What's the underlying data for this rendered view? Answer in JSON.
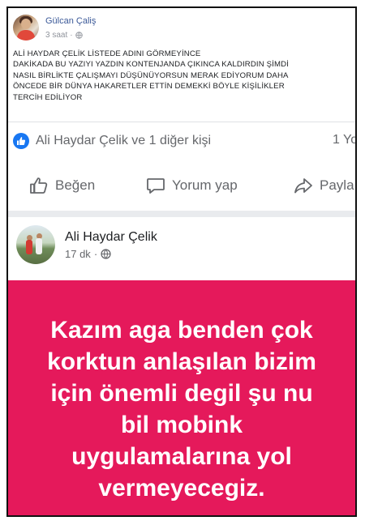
{
  "post1": {
    "author": "Gülcan Çaliş",
    "time": "3 saat",
    "separator": "·",
    "text_lines": [
      "ALİ HAYDAR ÇELİK LİSTEDE ADINI GÖRMEYİNCE",
      "DAKİKADA BU YAZIYI YAZDIN KONTENJANDA ÇIKINCA KALDIRDIN ŞİMDİ",
      "NASIL BİRLİKTE ÇALIŞMAYI DÜŞÜNÜYORSUN MERAK EDİYORUM DAHA",
      "ÖNCEDE BİR DÜNYA HAKARETLER ETTİN DEMEKKİ BÖYLE KİŞİLİKLER",
      "TERCİH EDİLİYOR"
    ],
    "reactions": "Ali Haydar Çelik ve 1 diğer kişi",
    "count": "1 Yo",
    "actions": {
      "like": "Beğen",
      "comment": "Yorum yap",
      "share": "Payla"
    }
  },
  "post2": {
    "author": "Ali Haydar Çelik",
    "time": "17 dk",
    "separator": "·",
    "image_lines": [
      "Kazım aga benden çok",
      "korktun anlaşılan bizim",
      "için önemli degil şu nu",
      "bil mobink",
      "uygulamalarına yol",
      "vermeyecegiz."
    ],
    "image_bg": "#e5195b"
  },
  "colors": {
    "link": "#3b5998",
    "accent": "#1877f2",
    "secondary_text": "#65676b"
  }
}
